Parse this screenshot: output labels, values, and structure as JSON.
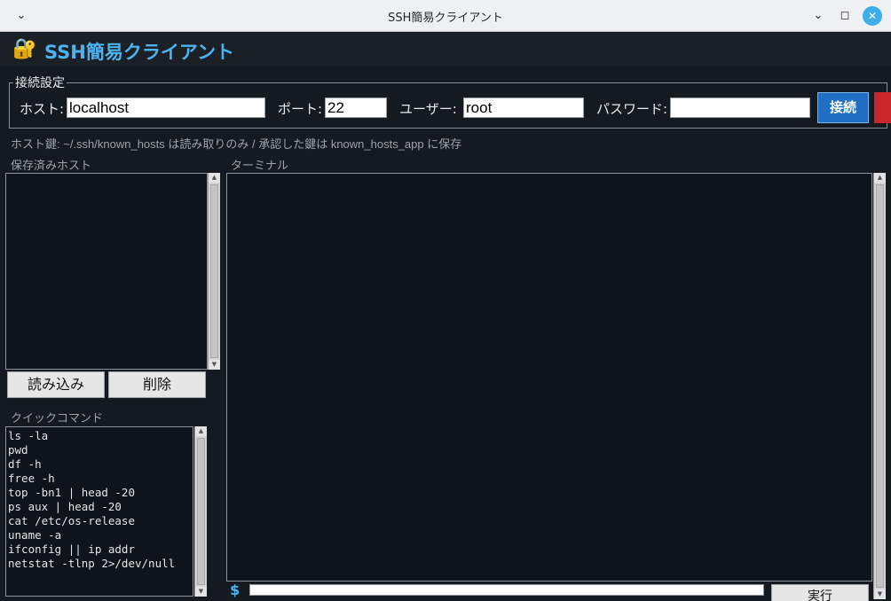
{
  "window": {
    "title": "SSH簡易クライアント",
    "menu_icon": "chevron-down-icon",
    "minimize_icon": "minimize-icon",
    "maximize_icon": "maximize-icon",
    "close_icon": "close-icon"
  },
  "header": {
    "icon": "lock-icon",
    "title": "SSH簡易クライアント",
    "accent_color": "#4db3ee"
  },
  "connection": {
    "group_label": "接続設定",
    "host_label": "ホスト:",
    "host_value": "localhost",
    "port_label": "ポート:",
    "port_value": "22",
    "user_label": "ユーザー:",
    "user_value": "root",
    "password_label": "パスワード:",
    "password_value": "",
    "connect_label": "接続",
    "connect_color": "#1f6fc4",
    "disconnect_color": "#c8262b"
  },
  "host_key_note": "ホスト鍵: ~/.ssh/known_hosts は読み取りのみ / 承認した鍵は known_hosts_app に保存",
  "saved_hosts": {
    "label": "保存済みホスト",
    "items": [],
    "load_label": "読み込み",
    "delete_label": "削除"
  },
  "quick_commands": {
    "label": "クイックコマンド",
    "items": [
      "ls -la",
      "pwd",
      "df -h",
      "free -h",
      "top -bn1 | head -20",
      "ps aux | head -20",
      "cat /etc/os-release",
      "uname -a",
      "ifconfig || ip addr",
      "netstat -tlnp 2>/dev/null"
    ]
  },
  "terminal": {
    "label": "ターミナル",
    "output": "",
    "prompt": "$",
    "input_value": "",
    "run_label": "実行"
  }
}
